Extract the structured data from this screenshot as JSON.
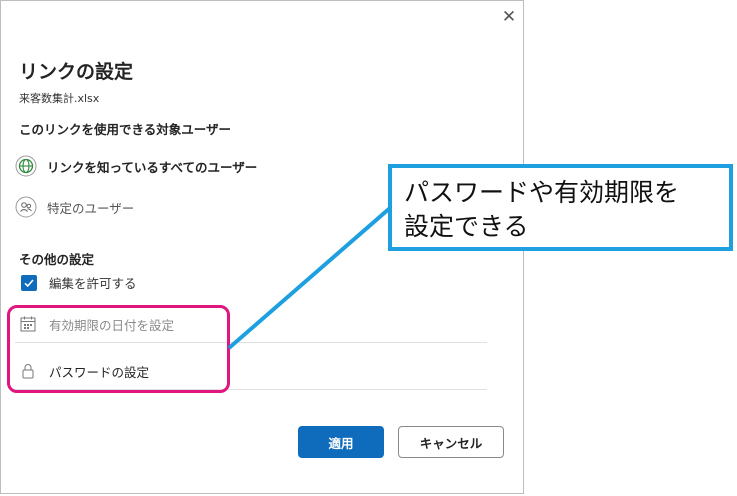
{
  "dialog": {
    "title": "リンクの設定",
    "filename": "来客数集計.xlsx",
    "audience_heading": "このリンクを使用できる対象ユーザー",
    "audience_options": [
      {
        "label": "リンクを知っているすべてのユーザー",
        "icon": "globe-icon",
        "selected": true
      },
      {
        "label": "特定のユーザー",
        "icon": "people-icon",
        "selected": false
      }
    ],
    "other_heading": "その他の設定",
    "allow_edit_label": "編集を許可する",
    "allow_edit_checked": true,
    "expiry_placeholder": "有効期限の日付を設定",
    "password_label": "パスワードの設定",
    "apply_label": "適用",
    "cancel_label": "キャンセル",
    "close_glyph": "✕"
  },
  "annotation": {
    "callout_line1": "パスワードや有効期限を",
    "callout_line2": "設定できる",
    "callout_border_color": "#1e9fe0",
    "highlight_color": "#e0157f"
  },
  "colors": {
    "accent": "#0f6cbd",
    "globe": "#2f8a3f"
  }
}
